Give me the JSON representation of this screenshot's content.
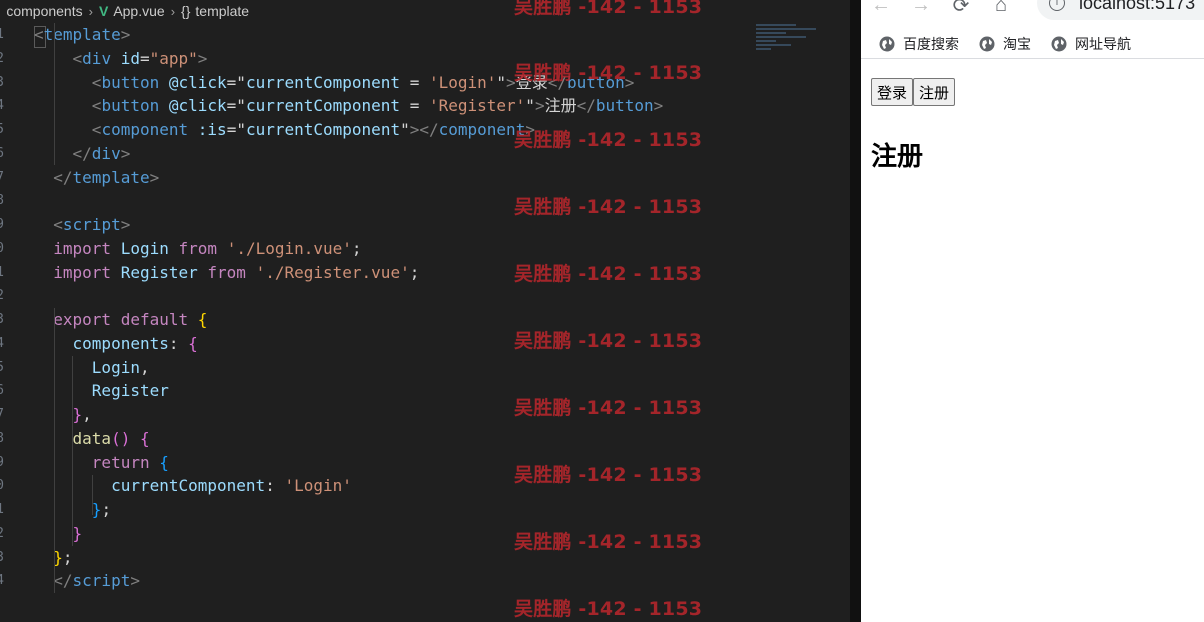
{
  "breadcrumb": {
    "folder": "components",
    "file": "App.vue",
    "symbol": "template",
    "file_icon": "vue-icon",
    "symbol_icon": "braces-icon"
  },
  "code_lines": [
    {
      "n": "1",
      "parts": [
        [
          "brk",
          "<"
        ],
        [
          "tag",
          "template"
        ],
        [
          "brk",
          ">"
        ]
      ]
    },
    {
      "n": "2",
      "parts": [
        [
          "plain",
          "    "
        ],
        [
          "brk",
          "<"
        ],
        [
          "tag",
          "div"
        ],
        [
          "plain",
          " "
        ],
        [
          "attr",
          "id"
        ],
        [
          "plain",
          "="
        ],
        [
          "str",
          "\"app\""
        ],
        [
          "brk",
          ">"
        ]
      ]
    },
    {
      "n": "3",
      "parts": [
        [
          "plain",
          "      "
        ],
        [
          "brk",
          "<"
        ],
        [
          "tag",
          "button"
        ],
        [
          "plain",
          " "
        ],
        [
          "attr",
          "@click"
        ],
        [
          "plain",
          "=\""
        ],
        [
          "var",
          "currentComponent"
        ],
        [
          "plain",
          " = "
        ],
        [
          "str",
          "'Login'"
        ],
        [
          "plain",
          "\""
        ],
        [
          "brk",
          ">"
        ],
        [
          "plain",
          "登录"
        ],
        [
          "brk",
          "</"
        ],
        [
          "tag",
          "button"
        ],
        [
          "brk",
          ">"
        ]
      ]
    },
    {
      "n": "4",
      "parts": [
        [
          "plain",
          "      "
        ],
        [
          "brk",
          "<"
        ],
        [
          "tag",
          "button"
        ],
        [
          "plain",
          " "
        ],
        [
          "attr",
          "@click"
        ],
        [
          "plain",
          "=\""
        ],
        [
          "var",
          "currentComponent"
        ],
        [
          "plain",
          " = "
        ],
        [
          "str",
          "'Register'"
        ],
        [
          "plain",
          "\""
        ],
        [
          "brk",
          ">"
        ],
        [
          "plain",
          "注册"
        ],
        [
          "brk",
          "</"
        ],
        [
          "tag",
          "button"
        ],
        [
          "brk",
          ">"
        ]
      ]
    },
    {
      "n": "5",
      "parts": [
        [
          "plain",
          "      "
        ],
        [
          "brk",
          "<"
        ],
        [
          "tag",
          "component"
        ],
        [
          "plain",
          " "
        ],
        [
          "attr",
          ":is"
        ],
        [
          "plain",
          "=\""
        ],
        [
          "var",
          "currentComponent"
        ],
        [
          "plain",
          "\""
        ],
        [
          "brk",
          "></"
        ],
        [
          "tag",
          "component"
        ],
        [
          "brk",
          ">"
        ]
      ]
    },
    {
      "n": "6",
      "parts": [
        [
          "plain",
          "    "
        ],
        [
          "brk",
          "</"
        ],
        [
          "tag",
          "div"
        ],
        [
          "brk",
          ">"
        ]
      ]
    },
    {
      "n": "7",
      "parts": [
        [
          "plain",
          "  "
        ],
        [
          "brk",
          "</"
        ],
        [
          "tag",
          "template"
        ],
        [
          "brk",
          ">"
        ]
      ]
    },
    {
      "n": "8",
      "parts": []
    },
    {
      "n": "9",
      "parts": [
        [
          "plain",
          "  "
        ],
        [
          "brk",
          "<"
        ],
        [
          "tag",
          "script"
        ],
        [
          "brk",
          ">"
        ]
      ]
    },
    {
      "n": "0",
      "parts": [
        [
          "plain",
          "  "
        ],
        [
          "kw",
          "import"
        ],
        [
          "plain",
          " "
        ],
        [
          "var",
          "Login"
        ],
        [
          "plain",
          " "
        ],
        [
          "kw",
          "from"
        ],
        [
          "plain",
          " "
        ],
        [
          "str",
          "'./Login.vue'"
        ],
        [
          "plain",
          ";"
        ]
      ]
    },
    {
      "n": "1",
      "parts": [
        [
          "plain",
          "  "
        ],
        [
          "kw",
          "import"
        ],
        [
          "plain",
          " "
        ],
        [
          "var",
          "Register"
        ],
        [
          "plain",
          " "
        ],
        [
          "kw",
          "from"
        ],
        [
          "plain",
          " "
        ],
        [
          "str",
          "'./Register.vue'"
        ],
        [
          "plain",
          ";"
        ]
      ]
    },
    {
      "n": "2",
      "parts": []
    },
    {
      "n": "3",
      "parts": [
        [
          "plain",
          "  "
        ],
        [
          "kw",
          "export"
        ],
        [
          "plain",
          " "
        ],
        [
          "kw",
          "default"
        ],
        [
          "plain",
          " "
        ],
        [
          "ybrace",
          "{"
        ]
      ]
    },
    {
      "n": "4",
      "parts": [
        [
          "plain",
          "    "
        ],
        [
          "var",
          "components"
        ],
        [
          "plain",
          ": "
        ],
        [
          "pbrace",
          "{"
        ]
      ]
    },
    {
      "n": "5",
      "parts": [
        [
          "plain",
          "      "
        ],
        [
          "var",
          "Login"
        ],
        [
          "plain",
          ","
        ]
      ]
    },
    {
      "n": "6",
      "parts": [
        [
          "plain",
          "      "
        ],
        [
          "var",
          "Register"
        ]
      ]
    },
    {
      "n": "7",
      "parts": [
        [
          "plain",
          "    "
        ],
        [
          "pbrace",
          "}"
        ],
        [
          "plain",
          ","
        ]
      ]
    },
    {
      "n": "8",
      "parts": [
        [
          "plain",
          "    "
        ],
        [
          "fn",
          "data"
        ],
        [
          "pbrace",
          "()"
        ],
        [
          "plain",
          " "
        ],
        [
          "pbrace",
          "{"
        ]
      ]
    },
    {
      "n": "9",
      "parts": [
        [
          "plain",
          "      "
        ],
        [
          "kw",
          "return"
        ],
        [
          "plain",
          " "
        ],
        [
          "bbrace",
          "{"
        ]
      ]
    },
    {
      "n": "0",
      "parts": [
        [
          "plain",
          "        "
        ],
        [
          "var",
          "currentComponent"
        ],
        [
          "plain",
          ": "
        ],
        [
          "str",
          "'Login'"
        ]
      ]
    },
    {
      "n": "1",
      "parts": [
        [
          "plain",
          "      "
        ],
        [
          "bbrace",
          "}"
        ],
        [
          "plain",
          ";"
        ]
      ]
    },
    {
      "n": "2",
      "parts": [
        [
          "plain",
          "    "
        ],
        [
          "pbrace",
          "}"
        ]
      ]
    },
    {
      "n": "3",
      "parts": [
        [
          "plain",
          "  "
        ],
        [
          "ybrace",
          "}"
        ],
        [
          "plain",
          ";"
        ]
      ]
    },
    {
      "n": "4",
      "parts": [
        [
          "plain",
          "  "
        ],
        [
          "brk",
          "</"
        ],
        [
          "tag",
          "script"
        ],
        [
          "brk",
          ">"
        ]
      ]
    }
  ],
  "watermark": "吴胜鹏 -142 - 1153",
  "browser": {
    "url": "localhost:5173",
    "info_icon": "i",
    "bookmarks": [
      {
        "label": "百度搜索",
        "icon": "globe-icon"
      },
      {
        "label": "淘宝",
        "icon": "globe-icon"
      },
      {
        "label": "网址导航",
        "icon": "globe-icon"
      }
    ],
    "buttons": {
      "login": "登录",
      "register": "注册"
    },
    "heading": "注册"
  }
}
